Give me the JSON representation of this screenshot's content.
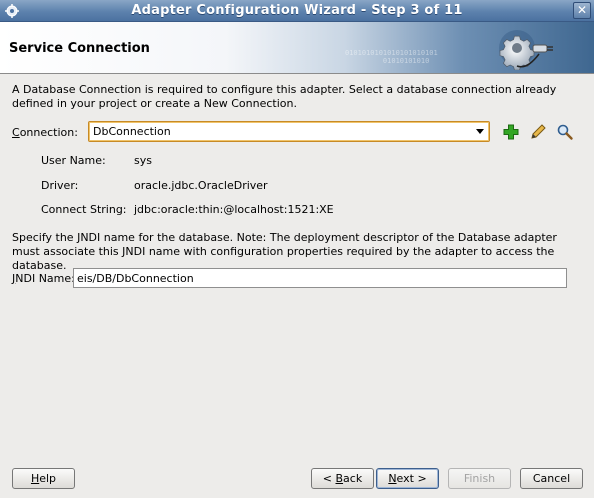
{
  "window": {
    "title": "Adapter Configuration Wizard - Step 3 of 11",
    "close_glyph": "✕"
  },
  "header": {
    "heading": "Service Connection",
    "decor_binary": "0101010101010101010101\n         01010101010",
    "icon": "gear-plug-icon"
  },
  "intro_text": "A Database Connection is required to configure this adapter. Select a database connection already defined in your project or create a New Connection.",
  "connection": {
    "label_mnemonic": "C",
    "label_rest": "onnection:",
    "selected": "DbConnection",
    "actions": [
      "add-icon",
      "edit-pencil-icon",
      "search-magnifier-icon"
    ]
  },
  "details": {
    "user_name_label": "User Name:",
    "user_name": "sys",
    "driver_label": "Driver:",
    "driver": "oracle.jdbc.OracleDriver",
    "connect_string_label": "Connect String:",
    "connect_string": "jdbc:oracle:thin:@localhost:1521:XE"
  },
  "jndi_text": "Specify the JNDI name for the database.  Note: The deployment descriptor of the Database adapter must associate this JNDI name with configuration properties required by the adapter to access the database.",
  "jndi": {
    "label_mnemonic": "J",
    "label_rest": "NDI Name:",
    "value": "eis/DB/DbConnection"
  },
  "buttons": {
    "help_mnemonic": "H",
    "help_rest": "elp",
    "back_prefix": "< ",
    "back_mnemonic": "B",
    "back_rest": "ack",
    "next_mnemonic": "N",
    "next_rest": "ext >",
    "finish": "Finish",
    "cancel": "Cancel"
  },
  "colors": {
    "titlebar": "#5d82ad",
    "combo_focus": "#c78a26",
    "add_green": "#2e9a1f"
  }
}
